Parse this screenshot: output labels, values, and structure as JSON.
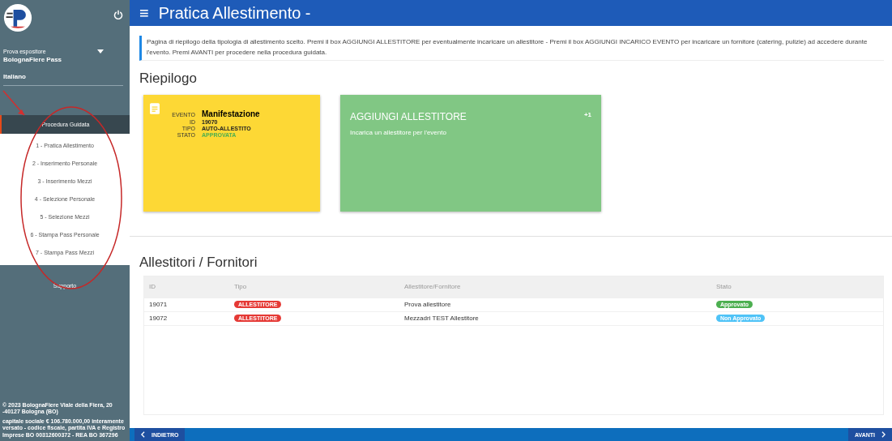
{
  "sidebar": {
    "user_role": "Prova espositore",
    "user_name": "BolognaFiere Pass",
    "language": "Italiano",
    "menu": [
      {
        "label": "Procedura Guidata",
        "expanded": true,
        "children": [
          {
            "label": "1 - Pratica Allestimento",
            "selected": false
          },
          {
            "label": "2 - Inserimento Personale",
            "selected": false
          },
          {
            "label": "3 - Inserimento Mezzi",
            "selected": false
          },
          {
            "label": "4 - Selezione Personale",
            "selected": false
          },
          {
            "label": "5 - Selezione Mezzi",
            "selected": false
          },
          {
            "label": "6 - Stampa Pass Personale",
            "selected": false
          },
          {
            "label": "7 - Stampa Pass Mezzi",
            "selected": false
          }
        ]
      },
      {
        "label": "Supporto",
        "expanded": false
      }
    ],
    "footer": [
      "© 2023 BolognaFiere Viale della Fiera, 20 -40127 Bologna (BO)",
      "capitale sociale € 106.780.000,00 interamente versato - codice fiscale, partita IVA e Registro Imprese BO 00312600372 - REA BO 367296"
    ]
  },
  "header": {
    "menu_icon": "≡",
    "title": "Pratica Allestimento -"
  },
  "info": "Pagina di riepilogo della tipologia di allestimento scelto. Premi il box AGGIUNGI ALLESTITORE per eventualmente incaricare un allestitore - Premi il box AGGIUNGI INCARICO EVENTO per incaricare un fornitore (catering, pulizie) ad accedere durante l'evento. Premi AVANTI per procedere nella procedura guidata.",
  "summary": {
    "title": "Riepilogo",
    "event_card": {
      "fields": [
        {
          "label": "EVENTO",
          "value": "Manifestazione",
          "kind": "title"
        },
        {
          "label": "ID",
          "value": "19070",
          "kind": "plain"
        },
        {
          "label": "TIPO",
          "value": "AUTO-ALLESTITO",
          "kind": "plain"
        },
        {
          "label": "STATO",
          "value": "APPROVATA",
          "kind": "status"
        }
      ]
    },
    "add_card": {
      "title": "AGGIUNGI ALLESTITORE",
      "count": "+1",
      "subtitle": "Incarica un allestitore per l'evento"
    }
  },
  "table": {
    "title": "Allestitori / Fornitori",
    "columns": [
      "ID",
      "Tipo",
      "Allestitore/Fornitore",
      "Stato"
    ],
    "rows": [
      {
        "id": "19071",
        "type": "ALLESTITORE",
        "name": "Prova allestitore",
        "status": "Approvato",
        "color": "#4caf50"
      },
      {
        "id": "19072",
        "type": "ALLESTITORE",
        "name": "Mezzadri TEST Allestitore",
        "status": "Non Approvato",
        "color": "#4fc3f7"
      }
    ]
  },
  "footer_bar": {
    "back": "INDIETRO",
    "next": "AVANTI"
  }
}
